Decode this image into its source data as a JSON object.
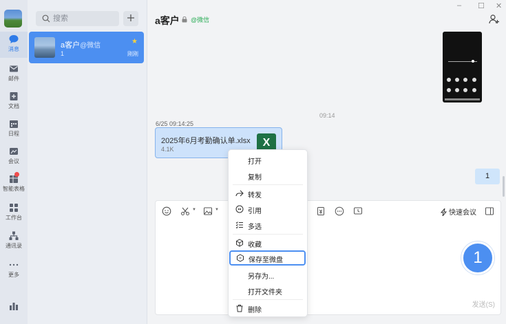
{
  "rail": {
    "items": [
      {
        "label": "消息",
        "icon": "chat-bubble-icon",
        "active": true
      },
      {
        "label": "邮件",
        "icon": "mail-icon"
      },
      {
        "label": "文档",
        "icon": "document-icon"
      },
      {
        "label": "日程",
        "icon": "calendar-icon"
      },
      {
        "label": "会议",
        "icon": "meeting-icon"
      },
      {
        "label": "智能表格",
        "icon": "smart-sheet-icon"
      },
      {
        "label": "工作台",
        "icon": "workbench-icon"
      },
      {
        "label": "通讯录",
        "icon": "contacts-icon"
      },
      {
        "label": "更多",
        "icon": "more-icon"
      }
    ]
  },
  "search": {
    "placeholder": "搜索"
  },
  "conversation": {
    "name": "a客户",
    "tag": "@微信",
    "preview": "1",
    "time": "刚刚",
    "starred": true
  },
  "chat": {
    "title": "a客户",
    "title_tag": "@微信",
    "window_controls": [
      "–",
      "☐",
      "✕"
    ],
    "timestamp": "09:14",
    "sender_time": "6/25 09:14:25",
    "file": {
      "name": "2025年6月考勤确认单.xlsx",
      "size": "4.1K",
      "type_letter": "X"
    },
    "my_message": "1"
  },
  "composer": {
    "quick_meeting": "快速会议",
    "send": "发送(S)"
  },
  "context_menu": {
    "items": [
      {
        "label": "打开",
        "icon": ""
      },
      {
        "label": "复制",
        "icon": ""
      },
      {
        "label": "转发",
        "icon": "forward-icon"
      },
      {
        "label": "引用",
        "icon": "quote-icon"
      },
      {
        "label": "多选",
        "icon": "multiselect-icon"
      },
      {
        "label": "收藏",
        "icon": "favorite-box-icon"
      },
      {
        "label": "保存至微盘",
        "icon": "save-to-drive-icon",
        "highlighted": true
      },
      {
        "label": "另存为...",
        "icon": ""
      },
      {
        "label": "打开文件夹",
        "icon": ""
      },
      {
        "label": "删除",
        "icon": "trash-icon"
      }
    ]
  },
  "callout": {
    "number": "1"
  },
  "colors": {
    "accent": "#4c8ff1",
    "excel_green": "#1e7145",
    "wechat_green": "#2fae5a"
  }
}
